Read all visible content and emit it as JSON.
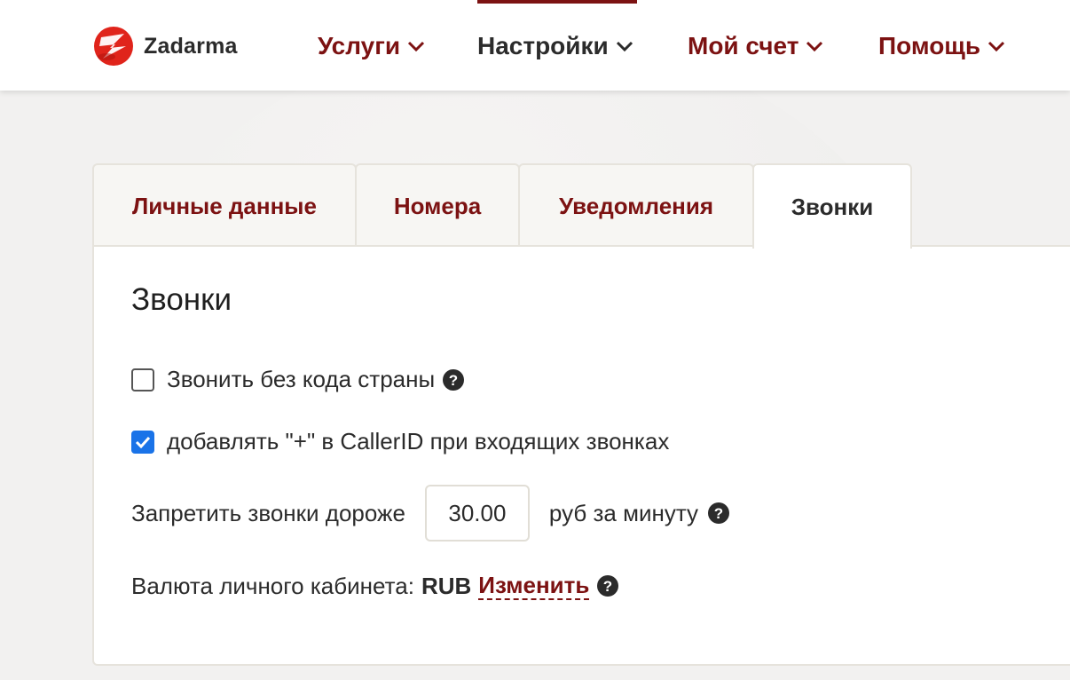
{
  "brand": {
    "name": "Zadarma",
    "accent_color": "#7c1212",
    "logo_color": "#e0241b"
  },
  "nav": {
    "items": [
      {
        "label": "Услуги",
        "active": false
      },
      {
        "label": "Настройки",
        "active": true
      },
      {
        "label": "Мой счет",
        "active": false
      },
      {
        "label": "Помощь",
        "active": false
      }
    ]
  },
  "tabs": [
    {
      "label": "Личные данные",
      "active": false
    },
    {
      "label": "Номера",
      "active": false
    },
    {
      "label": "Уведомления",
      "active": false
    },
    {
      "label": "Звонки",
      "active": true
    }
  ],
  "panel": {
    "title": "Звонки",
    "options": [
      {
        "label": "Звонить без кода страны",
        "checked": false,
        "help_icon": "question-circle-icon"
      },
      {
        "label": "добавлять \"+\" в CallerID при входящих звонках",
        "checked": true
      }
    ],
    "limit": {
      "label": "Запретить звонки дороже",
      "value": "30.00",
      "unit": "руб за минуту"
    },
    "currency": {
      "label": "Валюта личного кабинета:",
      "value": "RUB",
      "change_link": "Изменить"
    }
  }
}
